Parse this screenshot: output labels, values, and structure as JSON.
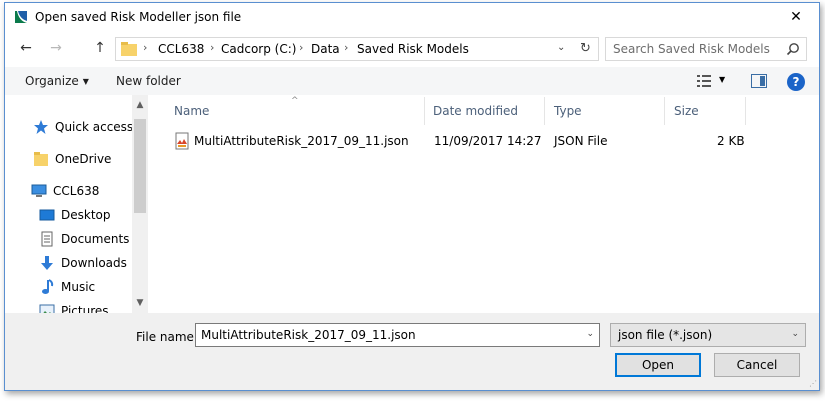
{
  "window": {
    "title": "Open saved Risk Modeller json file",
    "close_glyph": "✕"
  },
  "nav": {
    "back_glyph": "←",
    "forward_glyph": "→",
    "up_glyph": "↑",
    "breadcrumbs": [
      "CCL638",
      "Cadcorp (C:)",
      "Data",
      "Saved Risk Models"
    ],
    "separator": "›",
    "dropdown_glyph": "⌄",
    "refresh_glyph": "↻",
    "search_placeholder": "Search Saved Risk Models"
  },
  "toolbar": {
    "organize_label": "Organize",
    "new_folder_label": "New folder",
    "caret": "▼",
    "help_label": "?"
  },
  "sidebar": {
    "items": [
      {
        "label": "Quick access",
        "icon": "star-icon"
      },
      {
        "label": "OneDrive",
        "icon": "folder-icon"
      },
      {
        "label": "CCL638",
        "icon": "computer-icon"
      },
      {
        "label": "Desktop",
        "icon": "desktop-icon"
      },
      {
        "label": "Documents",
        "icon": "documents-icon"
      },
      {
        "label": "Downloads",
        "icon": "download-icon"
      },
      {
        "label": "Music",
        "icon": "music-icon"
      },
      {
        "label": "Pictures",
        "icon": "pictures-icon"
      }
    ],
    "scroll_up": "▲",
    "scroll_down": "▼"
  },
  "filelist": {
    "columns": [
      "Name",
      "Date modified",
      "Type",
      "Size"
    ],
    "sort_glyph": "^",
    "rows": [
      {
        "name": "MultiAttributeRisk_2017_09_11.json",
        "date": "11/09/2017 14:27",
        "type": "JSON File",
        "size": "2 KB"
      }
    ]
  },
  "footer": {
    "file_name_label": "File name:",
    "file_name_value": "MultiAttributeRisk_2017_09_11.json",
    "filter_value": "json file (*.json)",
    "open_label": "Open",
    "cancel_label": "Cancel",
    "caret": "⌄",
    "grip": "⋰"
  },
  "colors": {
    "accent": "#0078d7",
    "help": "#1b64c8",
    "column_header": "#4c607a"
  }
}
